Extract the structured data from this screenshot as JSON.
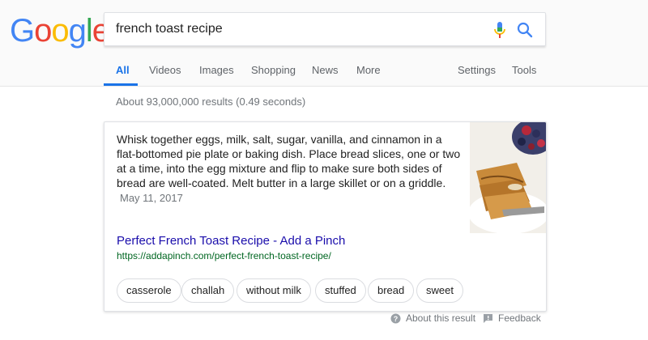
{
  "logo": {
    "letters": [
      "G",
      "o",
      "o",
      "g",
      "l",
      "e"
    ],
    "colors": [
      "#4285F4",
      "#EA4335",
      "#FBBC05",
      "#4285F4",
      "#34A853",
      "#EA4335"
    ]
  },
  "search": {
    "query": "french toast recipe"
  },
  "tabs": [
    {
      "label": "All",
      "active": true
    },
    {
      "label": "Videos"
    },
    {
      "label": "Images"
    },
    {
      "label": "Shopping"
    },
    {
      "label": "News"
    },
    {
      "label": "More"
    },
    {
      "label": "Settings"
    },
    {
      "label": "Tools"
    }
  ],
  "stats": "About 93,000,000 results (0.49 seconds)",
  "snippet": {
    "text": "Whisk together eggs, milk, salt, sugar, vanilla, and cinnamon in a flat-bottomed pie plate or baking dish. Place bread slices, one or two at a time, into the egg mixture and flip to make sure both sides of bread are well-coated. Melt butter in a large skillet or on a griddle.",
    "date": "May 11, 2017"
  },
  "result": {
    "title": "Perfect French Toast Recipe - Add a Pinch",
    "url": "https://addapinch.com/perfect-french-toast-recipe/"
  },
  "chips": [
    "casserole",
    "challah",
    "without milk",
    "stuffed",
    "bread",
    "sweet"
  ],
  "footer": {
    "about": "About this result",
    "feedback": "Feedback"
  },
  "colors": {
    "accent": "#1a73e8",
    "link": "#1a0dab",
    "url": "#006621"
  }
}
